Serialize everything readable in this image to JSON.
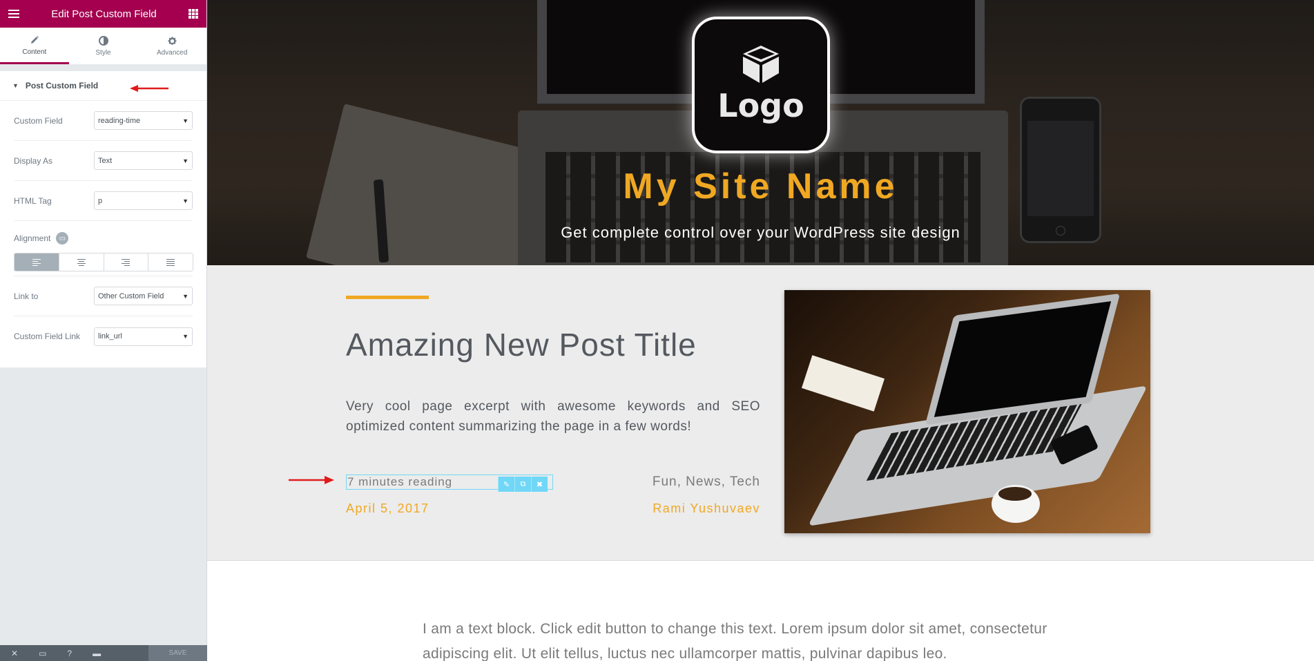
{
  "panel": {
    "title": "Edit Post Custom Field",
    "tabs": [
      {
        "label": "Content",
        "icon": "pencil-icon"
      },
      {
        "label": "Style",
        "icon": "half-circle-icon"
      },
      {
        "label": "Advanced",
        "icon": "gear-icon"
      }
    ],
    "section_title": "Post Custom Field",
    "controls": {
      "custom_field": {
        "label": "Custom Field",
        "value": "reading-time"
      },
      "display_as": {
        "label": "Display As",
        "value": "Text"
      },
      "html_tag": {
        "label": "HTML Tag",
        "value": "p"
      },
      "alignment": {
        "label": "Alignment",
        "selected": "left"
      },
      "link_to": {
        "label": "Link to",
        "value": "Other Custom Field"
      },
      "custom_field_link": {
        "label": "Custom Field Link",
        "value": "link_url"
      }
    },
    "footer": {
      "save_label": "SAVE"
    }
  },
  "hero": {
    "logo_text": "Logo",
    "site_name": "My Site Name",
    "tagline": "Get complete control over your WordPress site design"
  },
  "post": {
    "title": "Amazing New Post Title",
    "excerpt": "Very cool page excerpt with awesome keywords and SEO optimized content summarizing the page in a few words!",
    "reading_time": "7 minutes reading",
    "categories": "Fun, News, Tech",
    "date": "April 5, 2017",
    "author": "Rami Yushuvaev"
  },
  "text_block": "I am a text block. Click edit button to change this text. Lorem ipsum dolor sit amet, consectetur adipiscing elit. Ut elit tellus, luctus nec ullamcorper mattis, pulvinar dapibus leo.",
  "colors": {
    "panel_accent": "#a4004f",
    "site_accent": "#f0a823",
    "edit_highlight": "#71d7f7",
    "annotation_arrow": "#e01b1b"
  }
}
